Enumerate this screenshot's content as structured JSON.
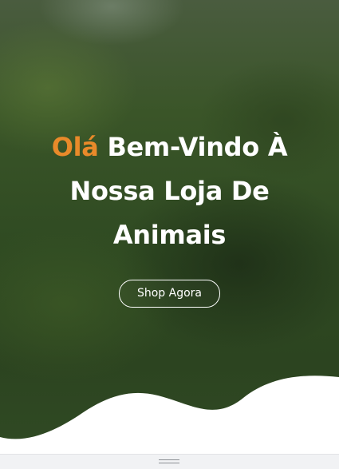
{
  "hero": {
    "headline_accent": "Olá",
    "headline_rest": "Bem-Vindo À Nossa Loja De Animais",
    "cta_label": "Shop Agora"
  },
  "icons": {
    "resize_handle": "drag-handle-icon"
  },
  "colors": {
    "accent": "#e98a2a",
    "headline_text": "#ffffff",
    "bottom_bar": "#f1f2f4"
  }
}
